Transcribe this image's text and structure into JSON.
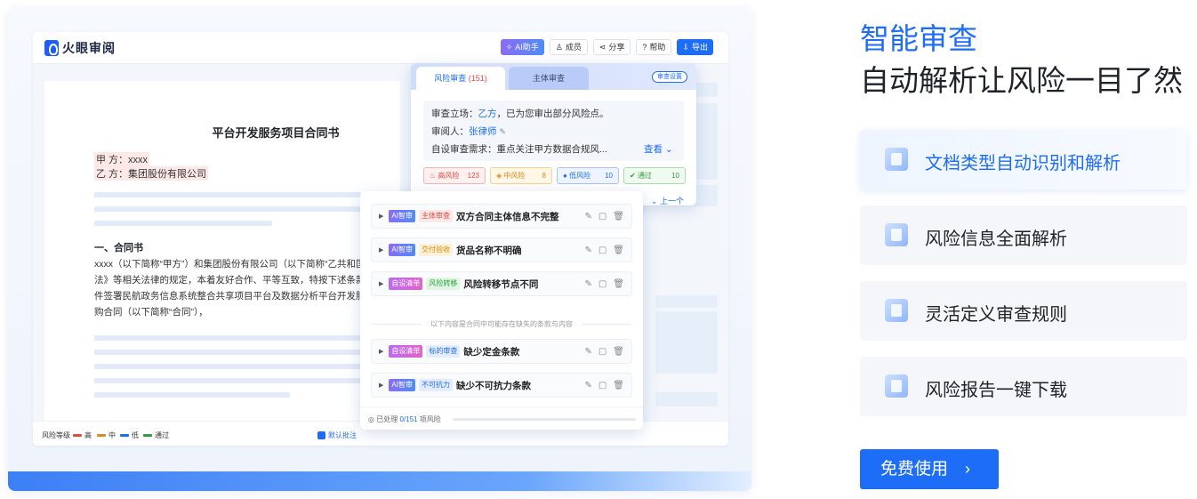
{
  "app": {
    "logo": "火眼审阅",
    "toolbar": {
      "ai": "AI助手",
      "members": "成员",
      "share": "分享",
      "help": "帮助",
      "export": "导出"
    }
  },
  "document": {
    "title": "平台开发服务项目合同书",
    "party_a": "甲 方：xxxx",
    "party_b": "乙 方：集团股份有限公司",
    "section": "一、合同书",
    "paragraph": "xxxx（以下简称“甲方”）和集团股份有限公司（以下简称“乙共和国合同法》等相关法律的规定，本着友好合作、平等互致，特按下述条款和条件签署民航政务信息系统整合共享项目平台及数据分析平台开发服务采购合同（以下简称“合同”），"
  },
  "legend": {
    "label": "风险等级",
    "high": "高",
    "mid": "中",
    "low": "低",
    "pass": "通过",
    "default_batch": "默认批注"
  },
  "review_panel": {
    "tab_risk": "风险审查",
    "tab_risk_count": "(151)",
    "tab_subject": "主体审查",
    "settings": "审查设置",
    "stance_label": "审查立场：",
    "stance_party": "乙方",
    "stance_rest": "，已为您审出部分风险点。",
    "reviewer_label": "审阅人：",
    "reviewer": "张律师",
    "needs": "自设审查需求：重点关注甲方数据合规风...",
    "view": "查看",
    "chips": [
      {
        "label": "高风险",
        "count": "123"
      },
      {
        "label": "中风险",
        "count": "8"
      },
      {
        "label": "低风险",
        "count": "10"
      },
      {
        "label": "通过",
        "count": "10"
      }
    ],
    "prev": "上一个"
  },
  "risk_list": {
    "items": [
      {
        "source": "AI智审",
        "category": "主体审查",
        "text": "双方合同主体信息不完整"
      },
      {
        "source": "AI智审",
        "category": "交付验收",
        "text": "货品名称不明确"
      },
      {
        "source": "自设清单",
        "category": "风险转移",
        "text": "风险转移节点不同"
      }
    ],
    "divider": "以下内容是合同中可能存在缺失的条款与内容",
    "missing": [
      {
        "source": "自设清单",
        "category": "标的审查",
        "text": "缺少定金条款"
      },
      {
        "source": "AI智审",
        "category": "不可抗力",
        "text": "缺少不可抗力条款"
      }
    ],
    "footer_prefix": "已处理",
    "footer_progress": "0/151",
    "footer_suffix": "项风险"
  },
  "hero": {
    "title": "智能审查",
    "subtitle": "自动解析让风险一目了然",
    "features": [
      "文档类型自动识别和解析",
      "风险信息全面解析",
      "灵活定义审查规则",
      "风险报告一键下载"
    ],
    "cta": "免费使用"
  },
  "colors": {
    "accent": "#1e6df6",
    "high": "#e5483f",
    "mid": "#e08a16",
    "low": "#1e6df6",
    "pass": "#2f9d3f"
  },
  "icons": [
    "ai-icon",
    "user-icon",
    "share-icon",
    "help-icon",
    "export-icon",
    "edit-icon",
    "copy-icon",
    "delete-icon",
    "chevron-right-icon"
  ]
}
